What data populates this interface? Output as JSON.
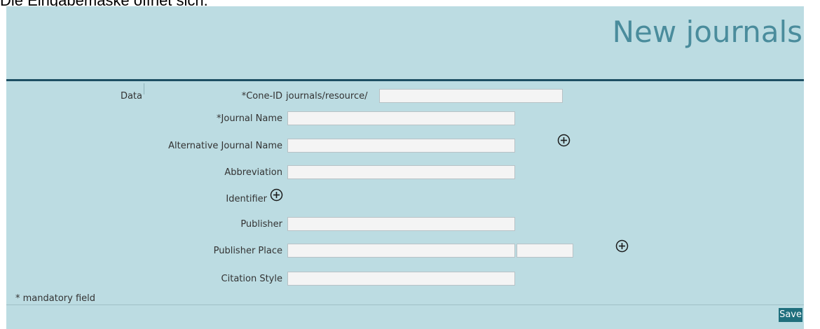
{
  "caption": "Die Eingabemaske öffnet sich.",
  "page_title": "New journals",
  "section_label": "Data",
  "form": {
    "cone_id": {
      "label": "*Cone-ID",
      "prefix": "journals/resource/",
      "value": ""
    },
    "journal_name": {
      "label": "*Journal Name",
      "value": ""
    },
    "alternative_journal_name": {
      "label": "Alternative Journal Name",
      "value": "",
      "add_icon": "plus-circle-icon"
    },
    "abbreviation": {
      "label": "Abbreviation",
      "value": ""
    },
    "identifier": {
      "label": "Identifier",
      "add_icon": "plus-circle-icon"
    },
    "publisher": {
      "label": "Publisher",
      "value": ""
    },
    "publisher_place": {
      "label": "Publisher Place",
      "value": "",
      "secondary_value": "",
      "add_icon": "plus-circle-icon"
    },
    "citation_style": {
      "label": "Citation Style",
      "value": ""
    }
  },
  "mandatory_note": "* mandatory field",
  "save_label": "Save",
  "colors": {
    "panel_background": "#bcdce2",
    "title": "#4a8c9c",
    "title_rule": "#1d4f63",
    "save_button": "#1f6f7d"
  }
}
